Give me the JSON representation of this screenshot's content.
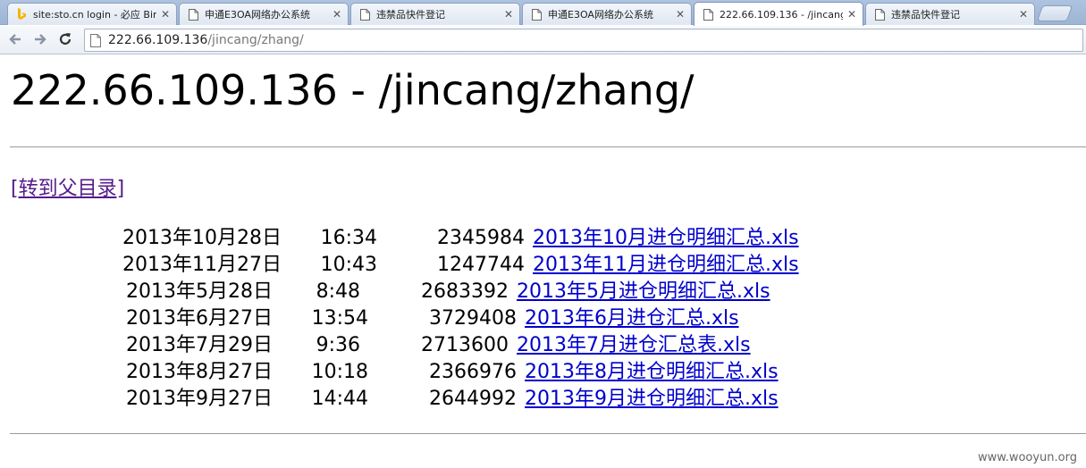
{
  "browser": {
    "tabs": [
      {
        "title": "site:sto.cn login - 必应 Bing",
        "favicon": "bing-icon",
        "active": false
      },
      {
        "title": "申通E3OA网络办公系统",
        "favicon": "page-icon",
        "active": false
      },
      {
        "title": "违禁品快件登记",
        "favicon": "page-icon",
        "active": false
      },
      {
        "title": "申通E3OA网络办公系统",
        "favicon": "page-icon",
        "active": false
      },
      {
        "title": "222.66.109.136 - /jincang/zhang/",
        "favicon": "page-icon",
        "active": true
      },
      {
        "title": "违禁品快件登记",
        "favicon": "page-icon",
        "active": false
      }
    ],
    "address": {
      "host": "222.66.109.136",
      "path": "/jincang/zhang/"
    }
  },
  "page": {
    "heading": "222.66.109.136 - /jincang/zhang/",
    "parent_link": "[转到父目录]",
    "files": [
      {
        "date": "2013年10月28日",
        "time": "16:34",
        "size": "2345984",
        "name": "2013年10月进仓明细汇总.xls"
      },
      {
        "date": "2013年11月27日",
        "time": "10:43",
        "size": "1247744",
        "name": "2013年11月进仓明细汇总.xls"
      },
      {
        "date": "2013年5月28日",
        "time": "8:48",
        "size": "2683392",
        "name": "2013年5月进仓明细汇总.xls"
      },
      {
        "date": "2013年6月27日",
        "time": "13:54",
        "size": "3729408",
        "name": "2013年6月进仓汇总.xls"
      },
      {
        "date": "2013年7月29日",
        "time": "9:36",
        "size": "2713600",
        "name": "2013年7月进仓汇总表.xls"
      },
      {
        "date": "2013年8月27日",
        "time": "10:18",
        "size": "2366976",
        "name": "2013年8月进仓明细汇总.xls"
      },
      {
        "date": "2013年9月27日",
        "time": "14:44",
        "size": "2644992",
        "name": "2013年9月进仓明细汇总.xls"
      }
    ]
  },
  "watermark": "www.wooyun.org",
  "colors": {
    "link": "#0000cc",
    "visited_link": "#551a8b",
    "tabstrip": "#aec3df"
  }
}
